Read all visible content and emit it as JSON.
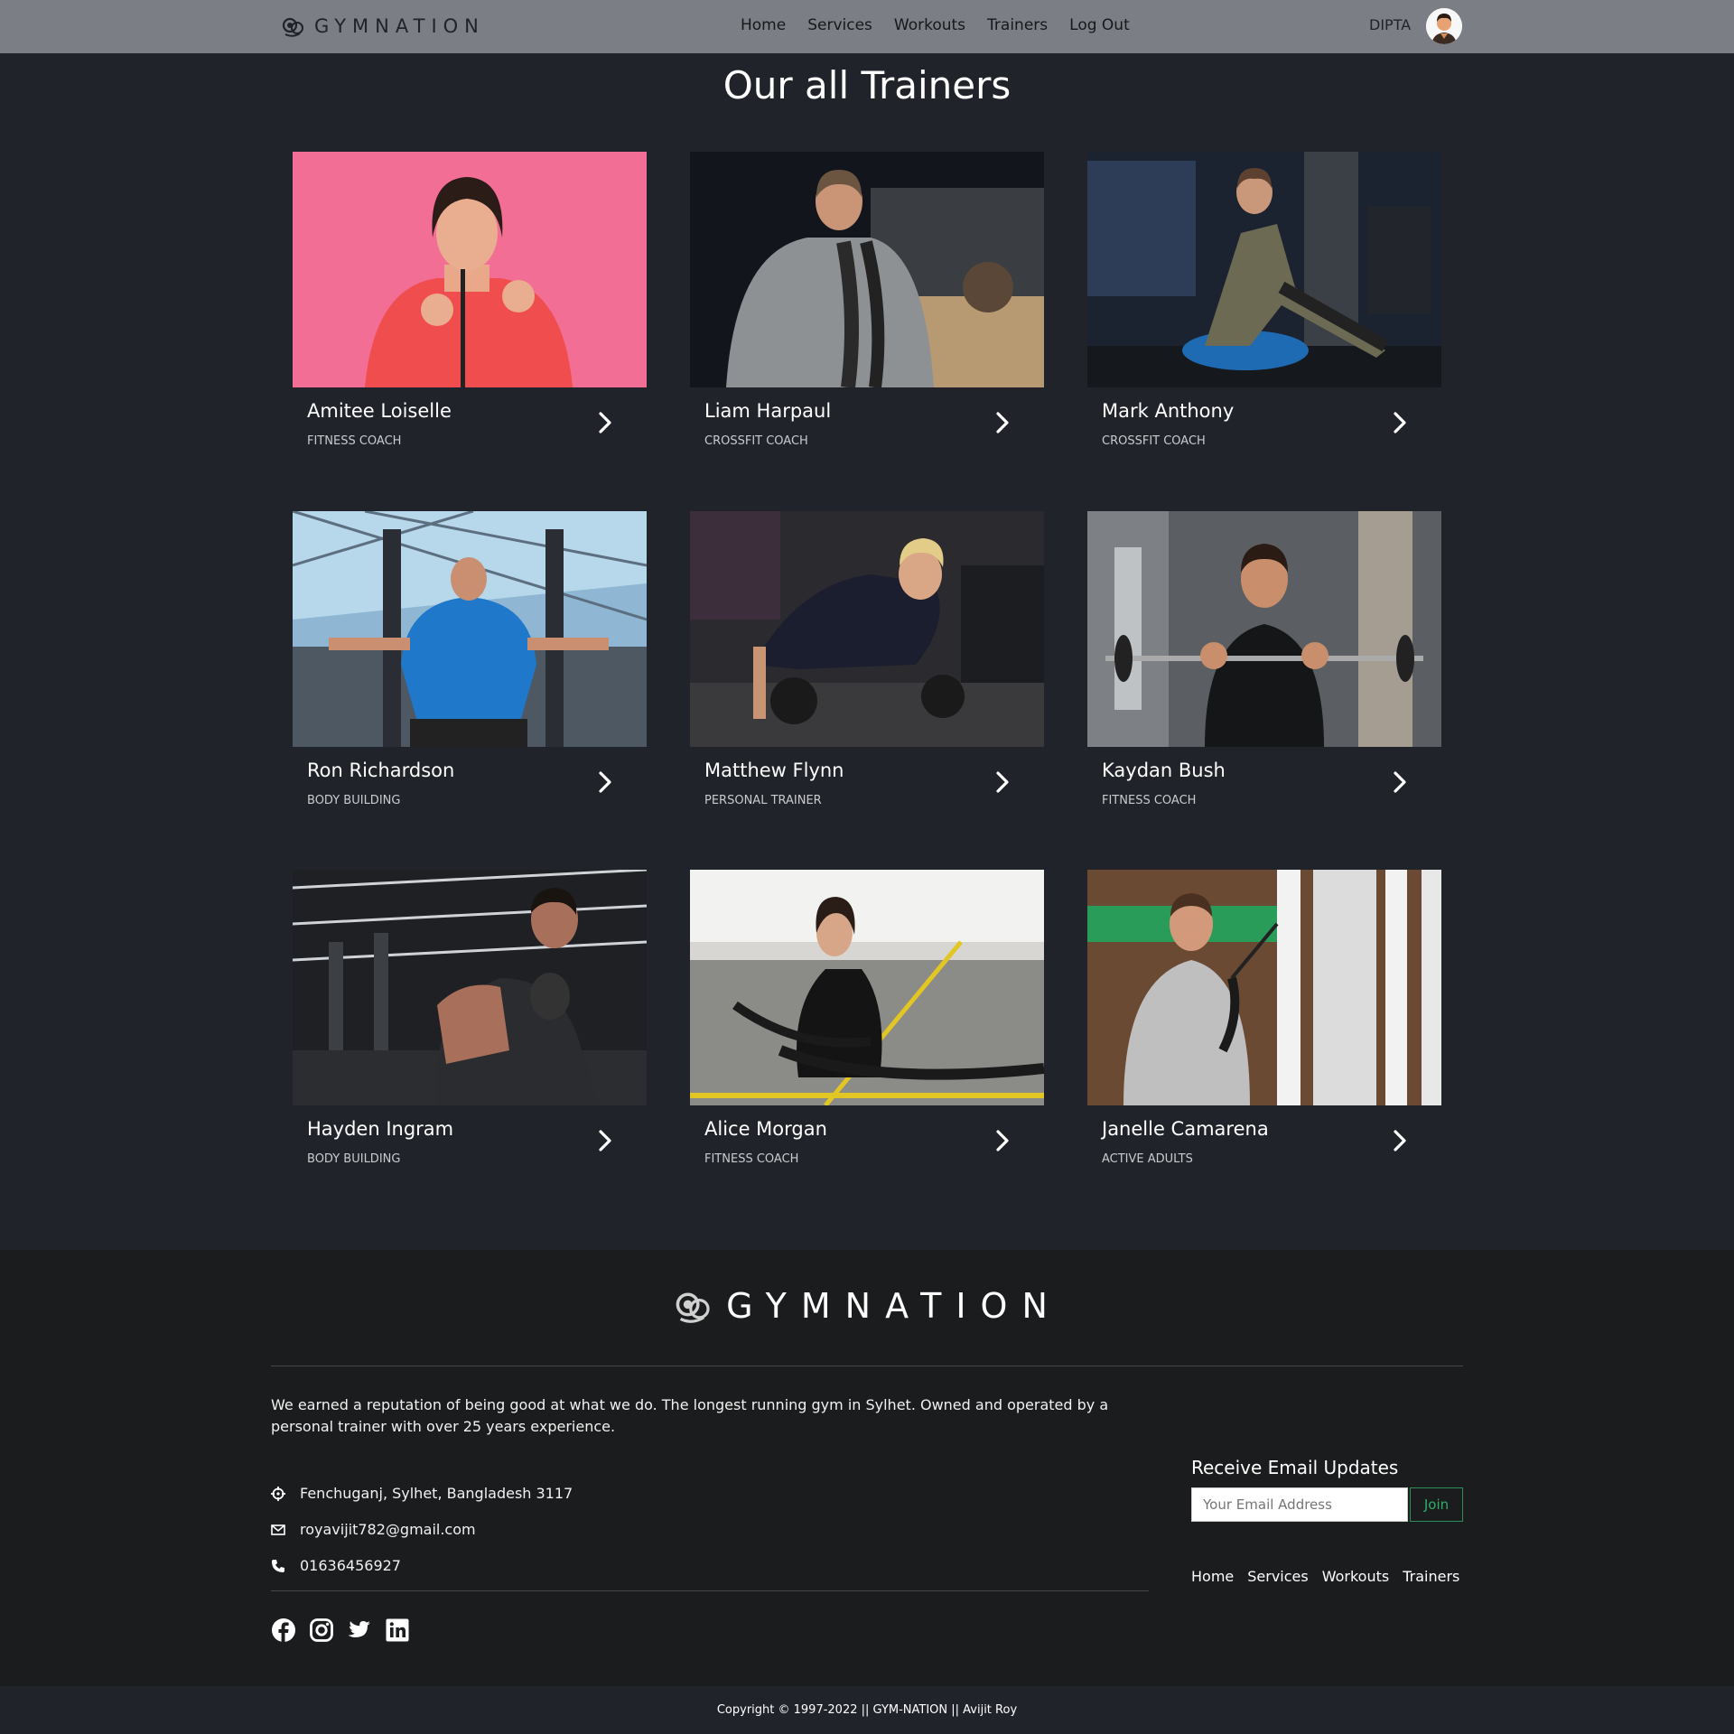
{
  "nav": {
    "brand": "GYMNATION",
    "links": [
      "Home",
      "Services",
      "Workouts",
      "Trainers",
      "Log Out"
    ],
    "user": "DIPTA"
  },
  "page": {
    "title": "Our all Trainers"
  },
  "trainers": [
    {
      "name": "Amitee Loiselle",
      "role": "FITNESS COACH"
    },
    {
      "name": "Liam Harpaul",
      "role": "CROSSFIT COACH"
    },
    {
      "name": "Mark Anthony",
      "role": "CROSSFIT COACH"
    },
    {
      "name": "Ron Richardson",
      "role": "BODY BUILDING"
    },
    {
      "name": "Matthew Flynn",
      "role": "PERSONAL TRAINER"
    },
    {
      "name": "Kaydan Bush",
      "role": "FITNESS COACH"
    },
    {
      "name": "Hayden Ingram",
      "role": "BODY BUILDING"
    },
    {
      "name": "Alice Morgan",
      "role": "FITNESS COACH"
    },
    {
      "name": "Janelle Camarena",
      "role": "ACTIVE ADULTS"
    }
  ],
  "footer": {
    "brand": "GYMNATION",
    "about": "We earned a reputation of being good at what we do. The longest running gym in Sylhet. Owned and operated by a personal trainer with over 25 years experience.",
    "address": "Fenchuganj, Sylhet, Bangladesh 3117",
    "email": "royavijit782@gmail.com",
    "phone": "01636456927",
    "newsletter_title": "Receive Email Updates",
    "email_placeholder": "Your Email Address",
    "join_label": "Join",
    "links": [
      "Home",
      "Services",
      "Workouts",
      "Trainers"
    ],
    "copyright": "Copyright © 1997-2022 || GYM-NATION || Avijit Roy"
  },
  "colors": {
    "background": "#202329",
    "navbar": "#7b7e84",
    "footer": "#1a1c1d",
    "accent_green": "#2fae6a"
  },
  "icons": [
    "logo-icon",
    "avatar",
    "chevron-right-icon",
    "location-icon",
    "mail-icon",
    "phone-icon",
    "facebook-icon",
    "instagram-icon",
    "twitter-icon",
    "linkedin-icon"
  ]
}
